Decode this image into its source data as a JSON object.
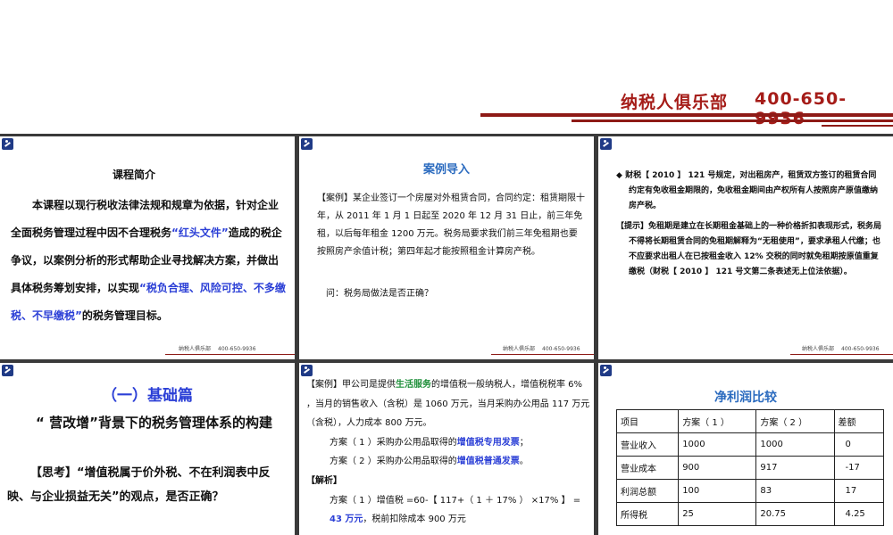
{
  "header": {
    "brand_name": "纳税人俱乐部",
    "brand_phone": "400-650-9936"
  },
  "footer": {
    "name": "纳税人俱乐部",
    "phone": "400-650-9936"
  },
  "colors": {
    "brand_red": "#a51c18",
    "highlight_blue": "#2b3fd6",
    "title_blue": "#2b6bbf",
    "green": "#1f8f3a",
    "icon_blue": "#1f3a86"
  },
  "slide1": {
    "title": "课程简介",
    "p1": "本课程以现行税收法律法规和规章为依据，针对企业全面税务管理过程中因不合理税务",
    "h1": "“红头文件”",
    "p2": "造成的税企争议，以案例分析的形式帮助企业寻找解决方案，并做出具体税务筹划安排，以实现",
    "h2": "“税负合理、风险可控、不多缴税、不早缴税”",
    "p3": "的税务管理目标。"
  },
  "slide2": {
    "title": "案例导入",
    "case": "【案例】某企业签订一个房屋对外租赁合同，合同约定：租赁期限十年，从 2011 年 1 月 1 日起至 2020 年 12 月 31 日止，前三年免租，以后每年租金 1200 万元。税务局要求我们前三年免租期也要按照房产余值计税；第四年起才能按照租金计算房产税。",
    "question": "问：税务局做法是否正确？"
  },
  "slide3": {
    "bullet_mark": "◆",
    "bullet": "财税【 2010 】 121 号规定，对出租房产，租赁双方签订的租赁合同约定有免收租金期限的，免收租金期间由产权所有人按照房产原值缴纳房产税。",
    "hint": "【提示】免租期是建立在长期租金基础上的一种价格折扣表现形式，税务局不得将长期租赁合同的免租期解释为“无租使用”，要求承租人代缴；也不应要求出租人在已按租金收入 12% 交税的同时就免租期按原值重复缴税（财税【 2010 】 121 号文第二条表述无上位法依据）。"
  },
  "slide4": {
    "title": "（一）基础篇",
    "subtitle": "“ 营改增”背景下的税务管理体系的构建",
    "think": "【思考】“增值税属于价外税、不在利润表中反映、与企业损益无关”的观点，是否正确？"
  },
  "slide5": {
    "l1a": "【案例】甲公司是提供",
    "l1g": "生活服务",
    "l1b": "的增值税一般纳税人，增值税税率 6% ，当月的销售收入（含税）是 1060 万元，当月采购办公用品 117 万元（含税），人力成本 800 万元。",
    "l2a": "方案（ 1 ）采购办公用品取得的",
    "l2b": "增值税专用发票",
    "l2c": "；",
    "l3a": "方案（ 2 ）采购办公用品取得的",
    "l3b": "增值税普通发票",
    "l3c": "。",
    "l4": "【解析】",
    "l5a": "方案（ 1 ）增值税 =60-【 117+（ 1 ＋ 17% ） ×17% 】 = ",
    "l5b": "43 万元",
    "l5c": "，税前扣除成本 900 万元"
  },
  "slide6": {
    "title": "净利润比较",
    "rows": [
      [
        "项目",
        "方案（ 1 ）",
        "方案（ 2 ）",
        "差额"
      ],
      [
        "营业收入",
        "1000",
        "1000",
        "0"
      ],
      [
        "营业成本",
        "900",
        "917",
        "-17"
      ],
      [
        "利润总额",
        "100",
        "83",
        "17"
      ],
      [
        "所得税",
        "25",
        "20.75",
        "4.25"
      ]
    ]
  }
}
